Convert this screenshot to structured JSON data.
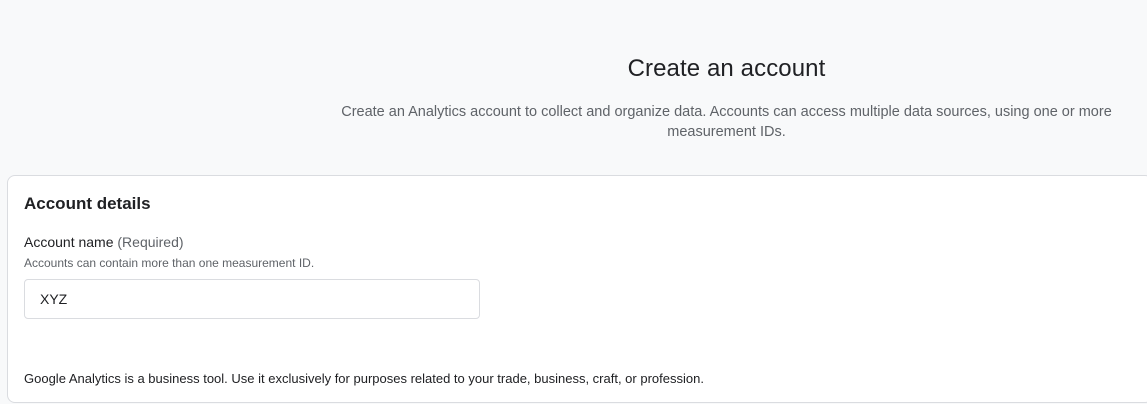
{
  "header": {
    "title": "Create an account",
    "description": "Create an Analytics account to collect and organize data. Accounts can access multiple data sources, using one or more measurement IDs."
  },
  "account_details": {
    "heading": "Account details",
    "account_name": {
      "label": "Account name",
      "required_note": "(Required)",
      "hint": "Accounts can contain more than one measurement ID.",
      "value": "XYZ"
    },
    "disclaimer": "Google Analytics is a business tool. Use it exclusively for purposes related to your trade, business, craft, or profession."
  }
}
